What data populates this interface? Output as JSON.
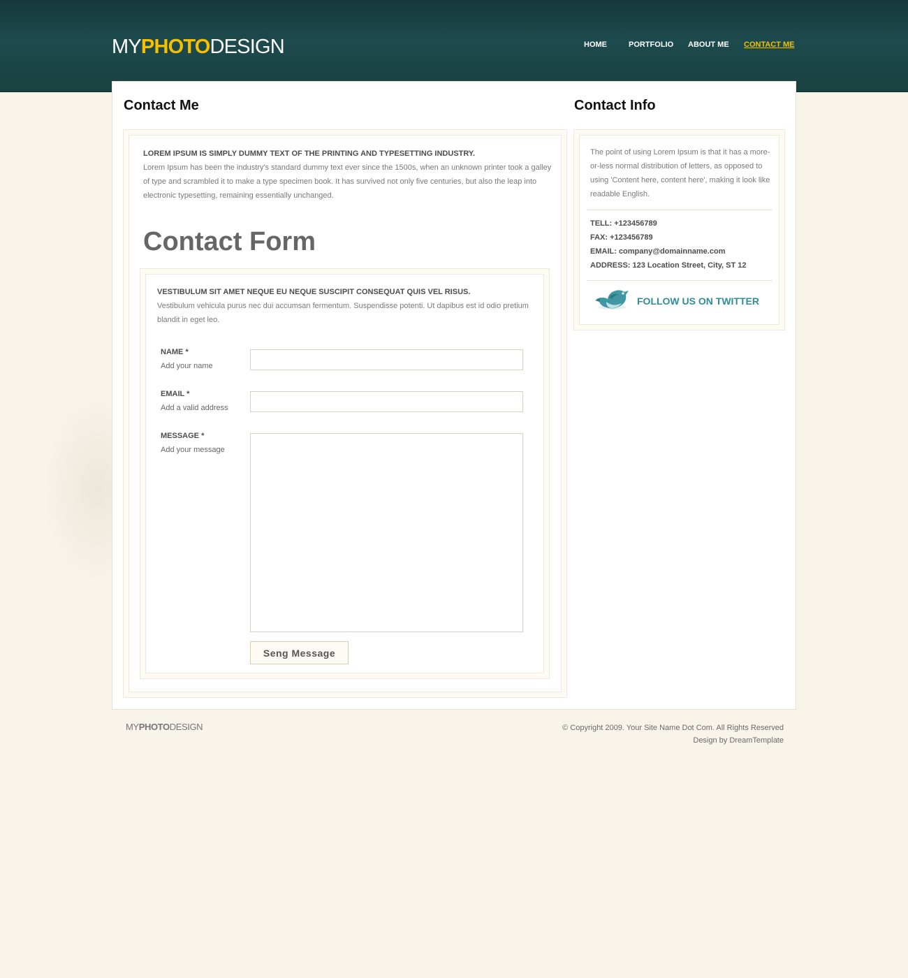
{
  "brand": {
    "logo_left": "MY",
    "logo_mid": "PHOTO",
    "logo_right": "DESIGN"
  },
  "nav": {
    "items": [
      {
        "label": "HOME"
      },
      {
        "label": "PORTFOLIO"
      },
      {
        "label": "ABOUT ME"
      },
      {
        "label": "CONTACT ME",
        "active": true
      }
    ]
  },
  "main": {
    "heading": "Contact Me",
    "intro_title": "LOREM IPSUM IS SIMPLY DUMMY TEXT OF THE PRINTING AND TYPESETTING INDUSTRY.",
    "intro_line1": "Lorem Ipsum has been the industry's standard dummy text ever since the 1500s, when an unknown printer took a galley",
    "intro_line2": "of type and scrambled it to make a type specimen book. It has survived not only five centuries, but also the leap into",
    "intro_line3": "electronic typesetting, remaining essentially unchanged.",
    "form_heading": "Contact Form",
    "form_title": "VESTIBULUM SIT AMET NEQUE EU NEQUE SUSCIPIT CONSEQUAT QUIS VEL RISUS.",
    "form_line1": "Vestibulum vehicula purus nec dui accumsan fermentum. Suspendisse potenti. Ut dapibus est id odio pretium",
    "form_line2": "blandit in eget leo.",
    "fields": {
      "name_label": "NAME *",
      "name_hint": "Add your name",
      "name_value": "",
      "email_label": "EMAIL *",
      "email_hint": "Add a valid address",
      "email_value": "",
      "message_label": "MESSAGE *",
      "message_hint": "Add your message",
      "message_value": ""
    },
    "submit_label": "Seng Message"
  },
  "sidebar": {
    "heading": "Contact Info",
    "blurb1": "The point of using Lorem Ipsum is that it has a more-",
    "blurb2": "or-less normal distribution of letters, as opposed to",
    "blurb3": "using 'Content here, content here', making it look like",
    "blurb4": "readable English.",
    "tell": "TELL: +123456789",
    "fax": "FAX: +123456789",
    "email": "EMAIL: company@domainname.com",
    "address": "ADDRESS: 123 Location Street, City, ST 12",
    "twitter_label": "FOLLOW US ON TWITTER"
  },
  "footer": {
    "logo_left": "MY",
    "logo_mid": "PHOTO",
    "logo_right": "DESIGN",
    "copyright": "© Copyright 2009. Your Site Name Dot Com. All Rights Reserved",
    "credit": "Design by DreamTemplate"
  },
  "colors": {
    "header": "#1d4a4d",
    "accent": "#f5c000",
    "page": "#f8f4ea",
    "twitter": "#2f8f98"
  }
}
